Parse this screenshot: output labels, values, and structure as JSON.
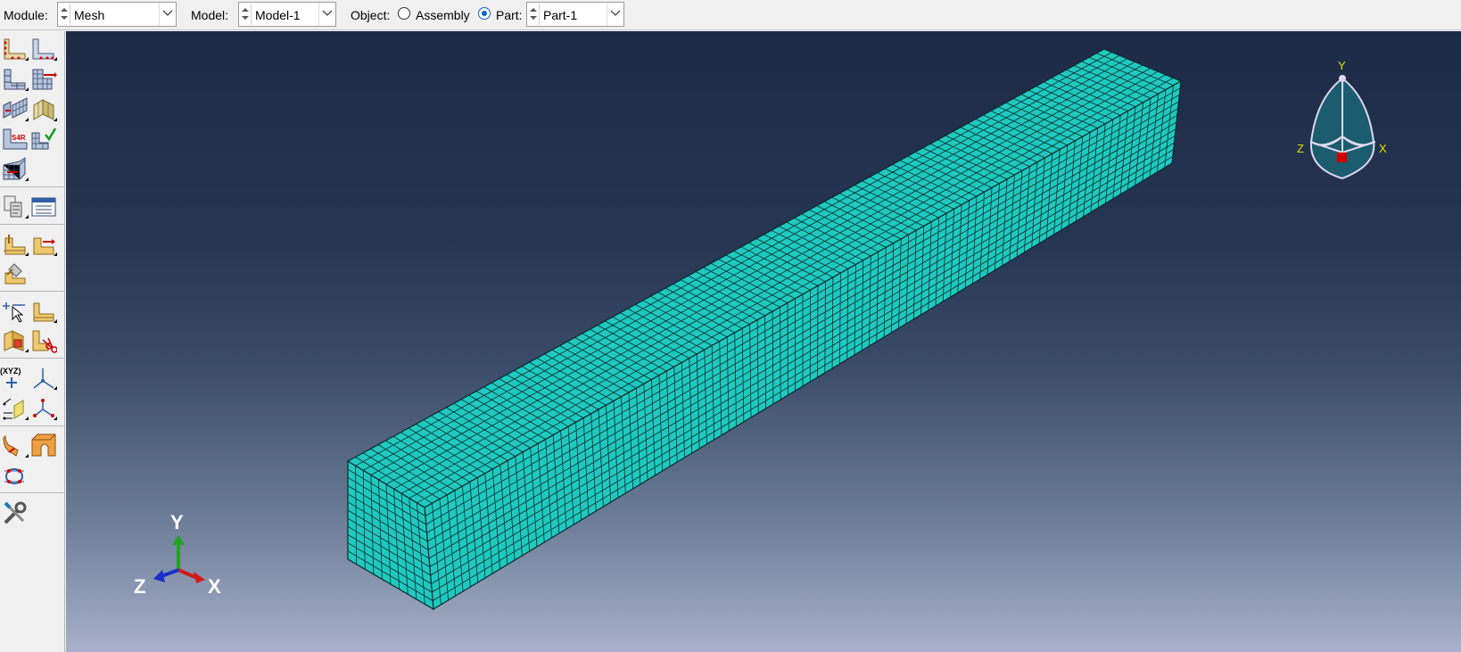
{
  "context_bar": {
    "module": {
      "label": "Module:",
      "value": "Mesh"
    },
    "model": {
      "label": "Model:",
      "value": "Model-1"
    },
    "object": {
      "label": "Object:",
      "assembly_label": "Assembly",
      "part_label": "Part:",
      "selected": "Part",
      "part_value": "Part-1"
    }
  },
  "toolbox": {
    "seed_tool_label": "S4R",
    "datum_csys_label": "(XYZ)"
  },
  "viewport": {
    "triad": {
      "x": "X",
      "y": "Y",
      "z": "Z"
    },
    "view_cube": {
      "x": "X",
      "y": "Y",
      "z": "Z"
    }
  },
  "colors": {
    "mesh_face": "#1fc9c0",
    "mesh_edge": "#0a2a2a",
    "axis_x": "#d11a1a",
    "axis_y": "#1fa41f",
    "axis_z": "#1a2ec8",
    "background_top": "#1d2a47",
    "background_bottom": "#a7b1c9"
  },
  "icons": [
    "seed-part-icon",
    "seed-edges-icon",
    "mesh-controls-icon",
    "element-type-icon",
    "mesh-part-icon",
    "delete-mesh-icon",
    "partition-face-icon",
    "partition-cell-icon",
    "assign-element-type-icon",
    "verify-mesh-icon",
    "mesh-region-icon",
    "query-icon",
    "manager-table-icon",
    "edit-mesh-icon",
    "edit-mesh-move-icon",
    "repair-icon",
    "create-datum-point-icon",
    "virtual-topology-icon",
    "combine-faces-icon",
    "cut-geometry-icon",
    "datum-point-icon",
    "datum-axis-icon",
    "datum-plane-icon",
    "datum-csys-icon",
    "extrude-solid-icon",
    "sweep-solid-icon",
    "partition-edge-icon",
    "tools-icon"
  ]
}
